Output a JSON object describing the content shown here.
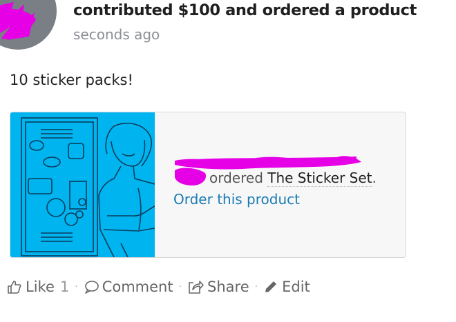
{
  "post": {
    "headline": "contributed $100 and ordered a product",
    "timestamp": "seconds ago",
    "text": "10 sticker packs!"
  },
  "card": {
    "ordered_word": "ordered",
    "product_name": "The Sticker Set",
    "period": ".",
    "order_link": "Order this product",
    "image_color": "#00b4f0"
  },
  "actions": {
    "like": "Like",
    "like_count": "1",
    "comment": "Comment",
    "share": "Share",
    "edit": "Edit",
    "separator": "·"
  },
  "colors": {
    "link": "#1a7bb5",
    "redaction": "#e600e6",
    "muted": "#8a8f94"
  }
}
